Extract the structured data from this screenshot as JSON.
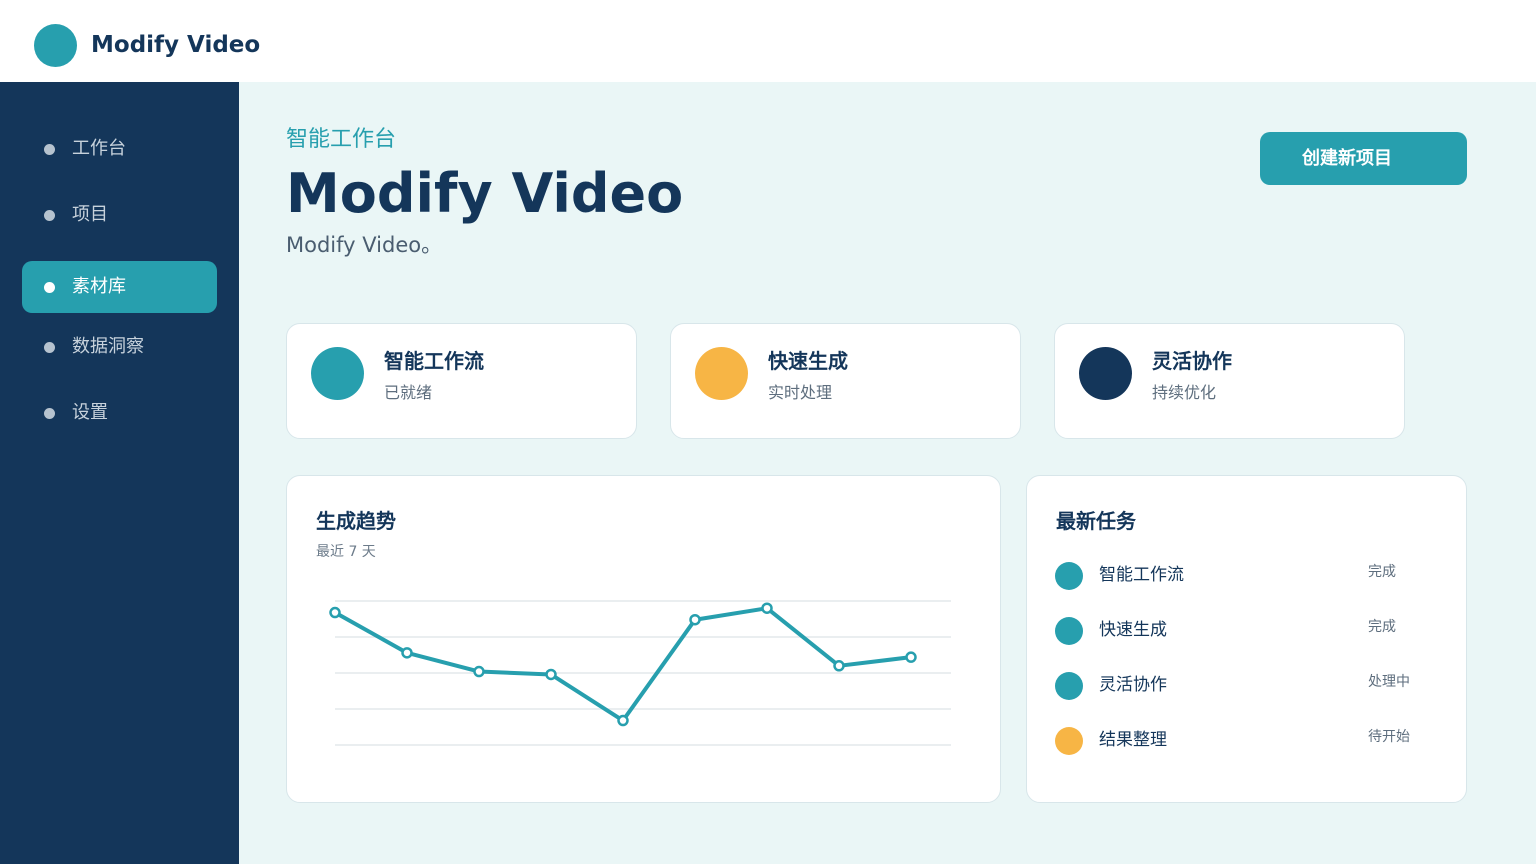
{
  "app": {
    "title": "Modify Video"
  },
  "sidebar": {
    "items": [
      {
        "label": "工作台",
        "active": false
      },
      {
        "label": "项目",
        "active": false
      },
      {
        "label": "素材库",
        "active": true
      },
      {
        "label": "数据洞察",
        "active": false
      },
      {
        "label": "设置",
        "active": false
      }
    ]
  },
  "header": {
    "eyebrow": "智能工作台",
    "title": "Modify Video",
    "subtitle": "Modify Video。",
    "create_button": "创建新项目"
  },
  "features": [
    {
      "title": "智能工作流",
      "subtitle": "已就绪",
      "color": "#279fae"
    },
    {
      "title": "快速生成",
      "subtitle": "实时处理",
      "color": "#f7b545"
    },
    {
      "title": "灵活协作",
      "subtitle": "持续优化",
      "color": "#14365a"
    }
  ],
  "trend_panel": {
    "title": "生成趋势",
    "subtitle": "最近 7 天"
  },
  "chart_data": {
    "type": "line",
    "values": [
      92,
      64,
      51,
      49,
      17,
      87,
      95,
      55,
      61
    ],
    "ylim": [
      0,
      100
    ],
    "grid": true,
    "color": "#279fae"
  },
  "tasks_panel": {
    "title": "最新任务",
    "tasks": [
      {
        "name": "智能工作流",
        "status": "完成",
        "color": "#279fae"
      },
      {
        "name": "快速生成",
        "status": "完成",
        "color": "#279fae"
      },
      {
        "name": "灵活协作",
        "status": "处理中",
        "color": "#279fae"
      },
      {
        "name": "结果整理",
        "status": "待开始",
        "color": "#f7b545"
      }
    ]
  }
}
